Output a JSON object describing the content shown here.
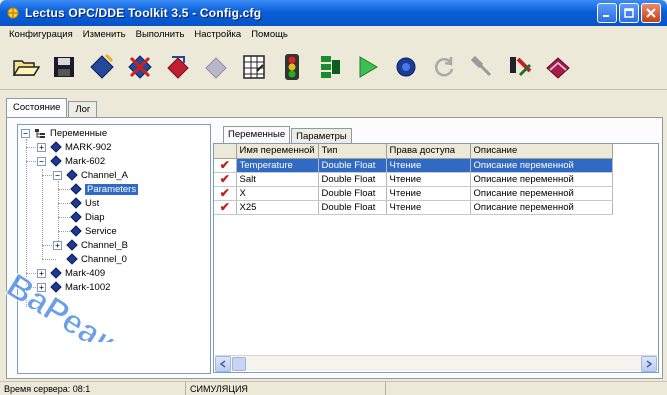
{
  "window": {
    "title": "Lectus OPC/DDE Toolkit 3.5 - Config.cfg",
    "colors": {
      "titlebar": "#0a5fd8",
      "selection": "#316ac5",
      "check": "#c0201a"
    }
  },
  "menu": [
    "Конфигурация",
    "Изменить",
    "Выполнить",
    "Настройка",
    "Помощь"
  ],
  "toolbar": {
    "icons": [
      "open-folder-icon",
      "save-disk-icon",
      "blue-tag-icon",
      "red-tag-icon",
      "red-tag-arrow-icon",
      "disabled-tag-icon",
      "spreadsheet-icon",
      "traffic-light-icon",
      "tree-icon",
      "play-icon",
      "record-icon",
      "refresh-icon",
      "wrench-icon",
      "tools-icon",
      "book-icon"
    ]
  },
  "outer_tabs": [
    "Состояние",
    "Лог"
  ],
  "inner_tabs": [
    "Переменные",
    "Параметры"
  ],
  "tree": {
    "root": "Переменные",
    "items": [
      {
        "label": "MARK-902"
      },
      {
        "label": "Mark-602"
      },
      {
        "label": "Channel_A"
      },
      {
        "label": "Parameters"
      },
      {
        "label": "Ust"
      },
      {
        "label": "Diap"
      },
      {
        "label": "Service"
      },
      {
        "label": "Channel_B"
      },
      {
        "label": "Channel_0"
      },
      {
        "label": "Mark-409"
      },
      {
        "label": "Mark-1002"
      }
    ]
  },
  "grid": {
    "columns": [
      "Имя переменной",
      "Тип",
      "Права доступа",
      "Описание"
    ],
    "rows": [
      {
        "name": "Temperature",
        "type": "Double Float",
        "access": "Чтение",
        "desc": "Описание переменной",
        "checked": true,
        "selected": true
      },
      {
        "name": "Salt",
        "type": "Double Float",
        "access": "Чтение",
        "desc": "Описание переменной",
        "checked": true,
        "selected": false
      },
      {
        "name": "X",
        "type": "Double Float",
        "access": "Чтение",
        "desc": "Описание переменной",
        "checked": true,
        "selected": false
      },
      {
        "name": "X25",
        "type": "Double Float",
        "access": "Чтение",
        "desc": "Описание переменной",
        "checked": true,
        "selected": false
      }
    ]
  },
  "status": {
    "server_time_label": "Время сервера: 08:1",
    "mode": "СИМУЛЯЦИЯ"
  },
  "watermark": {
    "text": "ВаРеакт",
    "color": "#3a7fe0"
  }
}
